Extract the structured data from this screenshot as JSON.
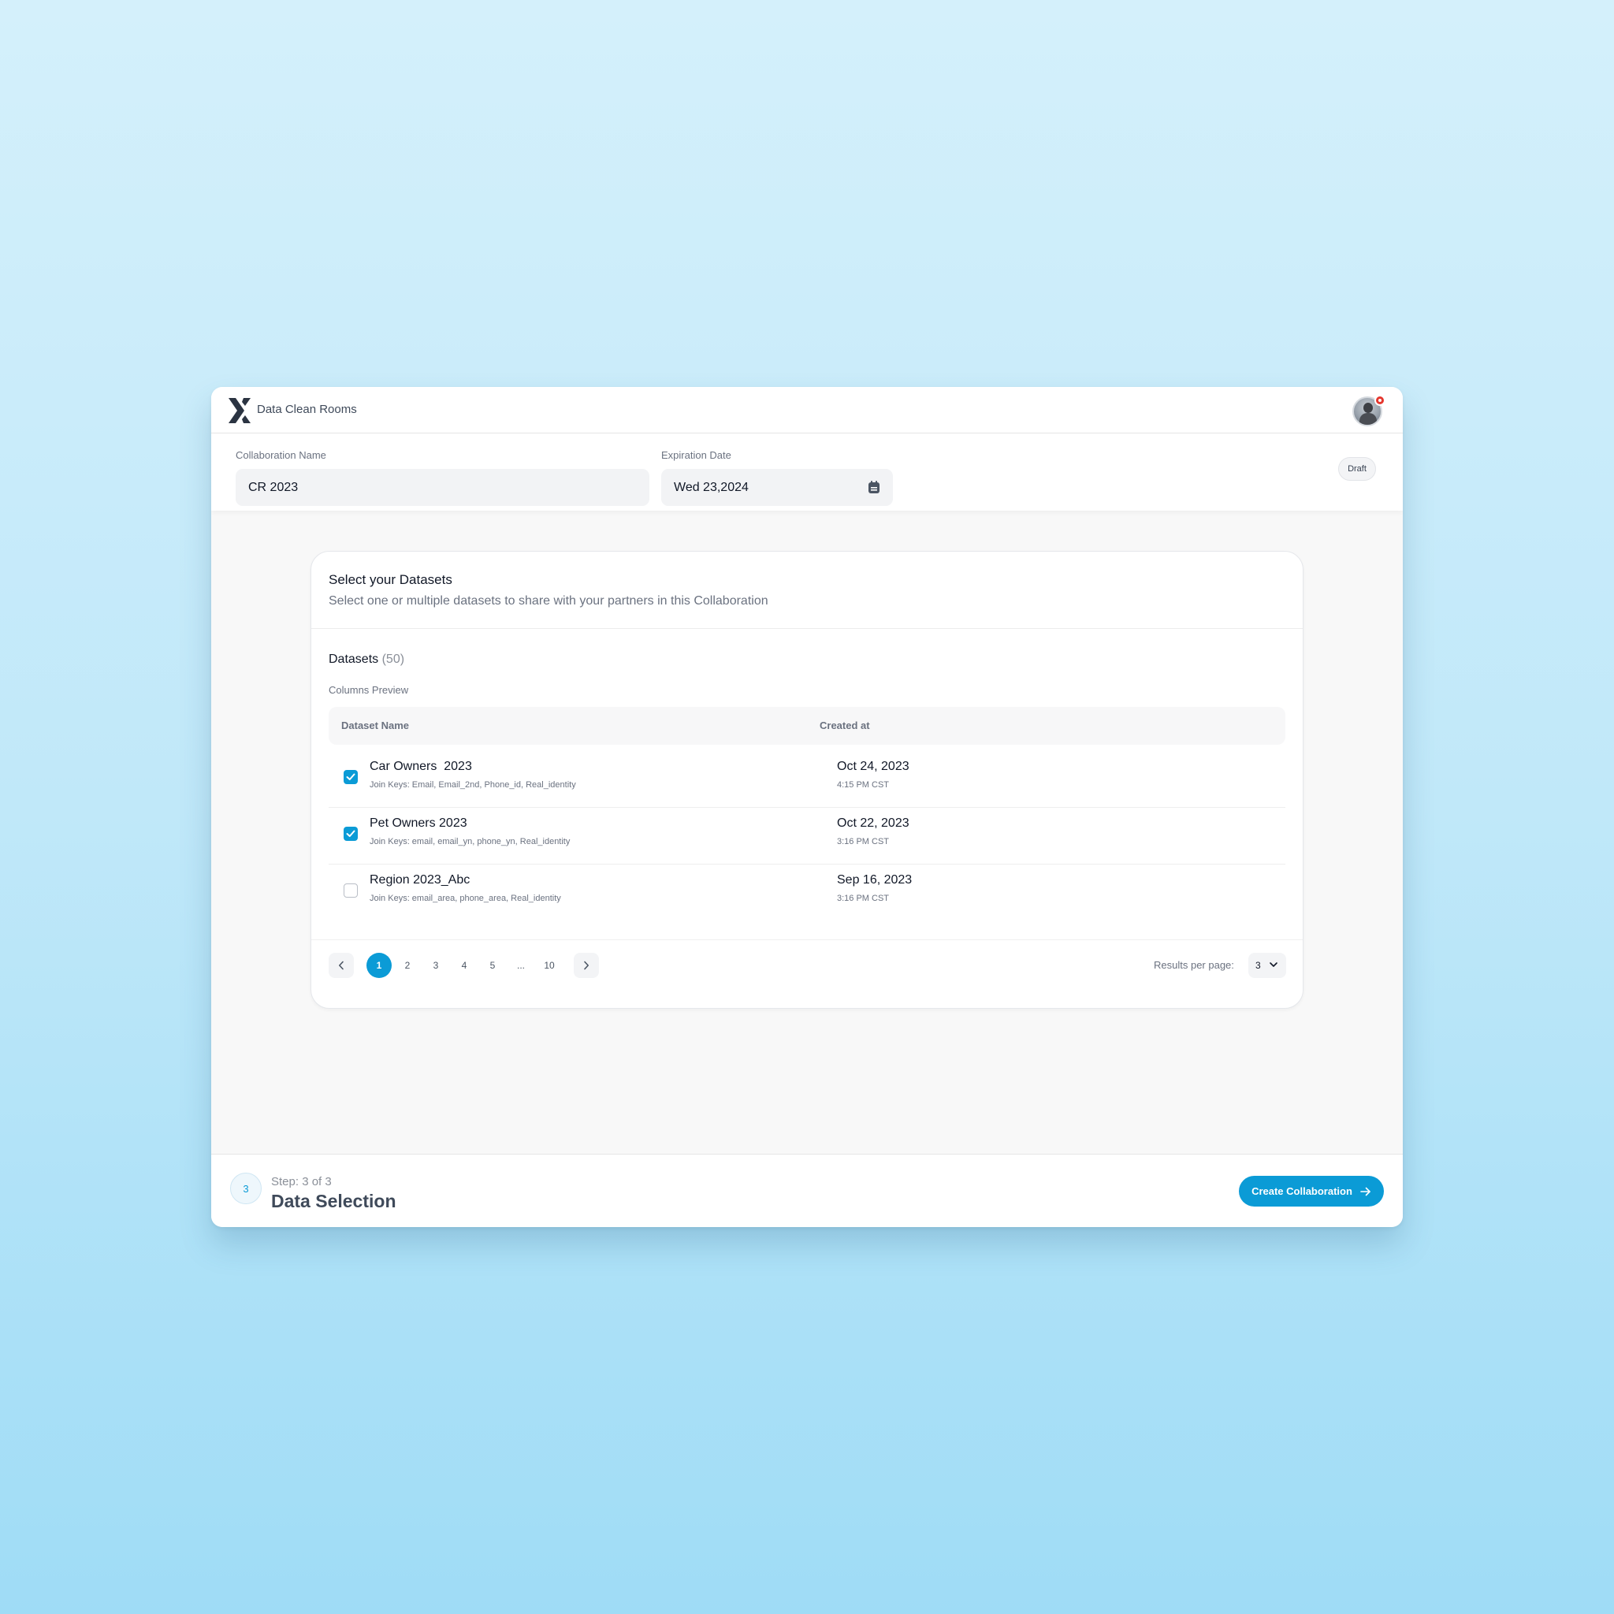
{
  "app": {
    "title": "Data Clean Rooms"
  },
  "form": {
    "name_label": "Collaboration Name",
    "name_value": "CR 2023",
    "date_label": "Expiration Date",
    "date_value": "Wed 23,2024",
    "status_badge": "Draft"
  },
  "card": {
    "title": "Select your Datasets",
    "subtitle": "Select one or multiple datasets to share with your partners in this Collaboration",
    "datasets_label": "Datasets",
    "datasets_count": "(50)",
    "columns_preview": "Columns Preview",
    "columns": {
      "name": "Dataset Name",
      "created": "Created at"
    },
    "rows": [
      {
        "name": "Car Owners  2023",
        "keys": "Join Keys: Email, Email_2nd, Phone_id, Real_identity",
        "date": "Oct 24, 2023",
        "time": "4:15 PM CST",
        "checked": true
      },
      {
        "name": "Pet Owners 2023",
        "keys": "Join Keys: email, email_yn, phone_yn, Real_identity",
        "date": "Oct 22, 2023",
        "time": "3:16 PM CST",
        "checked": true
      },
      {
        "name": "Region 2023_Abc",
        "keys": "Join Keys: email_area, phone_area, Real_identity",
        "date": "Sep 16, 2023",
        "time": "3:16 PM CST",
        "checked": false
      }
    ]
  },
  "pagination": {
    "pages": [
      "1",
      "2",
      "3",
      "4",
      "5",
      "...",
      "10"
    ],
    "active_page": "1",
    "results_label": "Results per page:",
    "results_value": "3"
  },
  "footer": {
    "step_number": "3",
    "step_text": "Step: 3 of 3",
    "step_title": "Data Selection",
    "create_label": "Create Collaboration"
  },
  "colors": {
    "accent": "#0b9bd6",
    "notification": "#e5372e"
  },
  "icons": [
    "logo-icon",
    "calendar-icon",
    "check-icon",
    "chevron-left-icon",
    "chevron-right-icon",
    "chevron-down-icon",
    "arrow-right-icon",
    "notification-dot-icon"
  ]
}
